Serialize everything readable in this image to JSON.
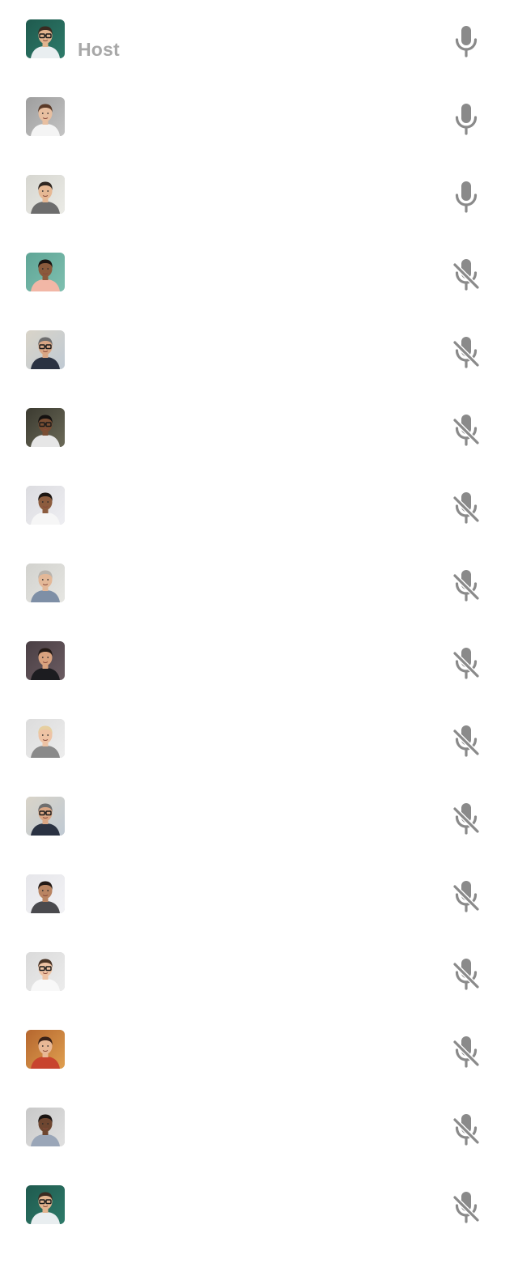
{
  "participants": [
    {
      "role_label": "Host",
      "muted": false,
      "avatar": {
        "bg": "#1f5a4e",
        "bg2": "#2e7b6a",
        "skin": "#e2b48f",
        "hair": "#3a2a20",
        "shirt": "#e9eef0",
        "glasses": true
      }
    },
    {
      "role_label": "",
      "muted": false,
      "avatar": {
        "bg": "#9e9e9e",
        "bg2": "#c4c4c4",
        "skin": "#e8bfa0",
        "hair": "#5a3a28",
        "shirt": "#f4f4f4",
        "glasses": false
      }
    },
    {
      "role_label": "",
      "muted": false,
      "avatar": {
        "bg": "#d6d6d0",
        "bg2": "#ebebe6",
        "skin": "#e6b894",
        "hair": "#2f2620",
        "shirt": "#6d6d6d",
        "glasses": false
      }
    },
    {
      "role_label": "",
      "muted": true,
      "avatar": {
        "bg": "#5fa596",
        "bg2": "#7fc0b0",
        "skin": "#8a5a3c",
        "hair": "#1b1411",
        "shirt": "#f2b7a6",
        "glasses": false
      }
    },
    {
      "role_label": "",
      "muted": true,
      "avatar": {
        "bg": "#d9d4c8",
        "bg2": "#c0cad4",
        "skin": "#d9a684",
        "hair": "#6e6e6e",
        "shirt": "#2a3242",
        "glasses": true
      }
    },
    {
      "role_label": "",
      "muted": true,
      "avatar": {
        "bg": "#3b3a30",
        "bg2": "#6b6a58",
        "skin": "#7a4e33",
        "hair": "#141110",
        "shirt": "#e6e6e6",
        "glasses": true
      }
    },
    {
      "role_label": "",
      "muted": true,
      "avatar": {
        "bg": "#dcdce0",
        "bg2": "#eeeef2",
        "skin": "#8c5c3e",
        "hair": "#1d1612",
        "shirt": "#f6f6f6",
        "glasses": false
      }
    },
    {
      "role_label": "",
      "muted": true,
      "avatar": {
        "bg": "#d2d2ce",
        "bg2": "#e6e6e2",
        "skin": "#e3b898",
        "hair": "#b9b4ad",
        "shirt": "#7e8fa6",
        "glasses": false
      }
    },
    {
      "role_label": "",
      "muted": true,
      "avatar": {
        "bg": "#4a3f44",
        "bg2": "#6b5c62",
        "skin": "#d9a27e",
        "hair": "#241a16",
        "shirt": "#1c1c20",
        "glasses": false
      }
    },
    {
      "role_label": "",
      "muted": true,
      "avatar": {
        "bg": "#dcdcdc",
        "bg2": "#ededed",
        "skin": "#eec3a4",
        "hair": "#e6cfa0",
        "shirt": "#8a8a8a",
        "glasses": false
      }
    },
    {
      "role_label": "",
      "muted": true,
      "avatar": {
        "bg": "#d9d4c8",
        "bg2": "#c0cad4",
        "skin": "#d9a684",
        "hair": "#6e6e6e",
        "shirt": "#2a3242",
        "glasses": true
      }
    },
    {
      "role_label": "",
      "muted": true,
      "avatar": {
        "bg": "#e6e6ea",
        "bg2": "#f2f2f5",
        "skin": "#b98462",
        "hair": "#241a16",
        "shirt": "#4a4a4e",
        "glasses": false
      }
    },
    {
      "role_label": "",
      "muted": true,
      "avatar": {
        "bg": "#dadada",
        "bg2": "#ececec",
        "skin": "#eec3a4",
        "hair": "#4a3426",
        "shirt": "#f8f8f8",
        "glasses": true
      }
    },
    {
      "role_label": "",
      "muted": true,
      "avatar": {
        "bg": "#b5662e",
        "bg2": "#e0a050",
        "skin": "#e8b896",
        "hair": "#3a2218",
        "shirt": "#c8442e",
        "glasses": false
      }
    },
    {
      "role_label": "",
      "muted": true,
      "avatar": {
        "bg": "#c8c8c8",
        "bg2": "#e0e0e0",
        "skin": "#6e4630",
        "hair": "#1a1412",
        "shirt": "#9aa6b8",
        "glasses": false
      }
    },
    {
      "role_label": "",
      "muted": true,
      "avatar": {
        "bg": "#1f5a4e",
        "bg2": "#2e7b6a",
        "skin": "#e2b48f",
        "hair": "#3a2a20",
        "shirt": "#e9eef0",
        "glasses": true
      }
    }
  ],
  "colors": {
    "icon": "#8a8a8a",
    "host_label": "#a8a8a8",
    "background": "#ffffff"
  },
  "icons": {
    "unmuted": "microphone-icon",
    "muted": "microphone-off-icon"
  }
}
